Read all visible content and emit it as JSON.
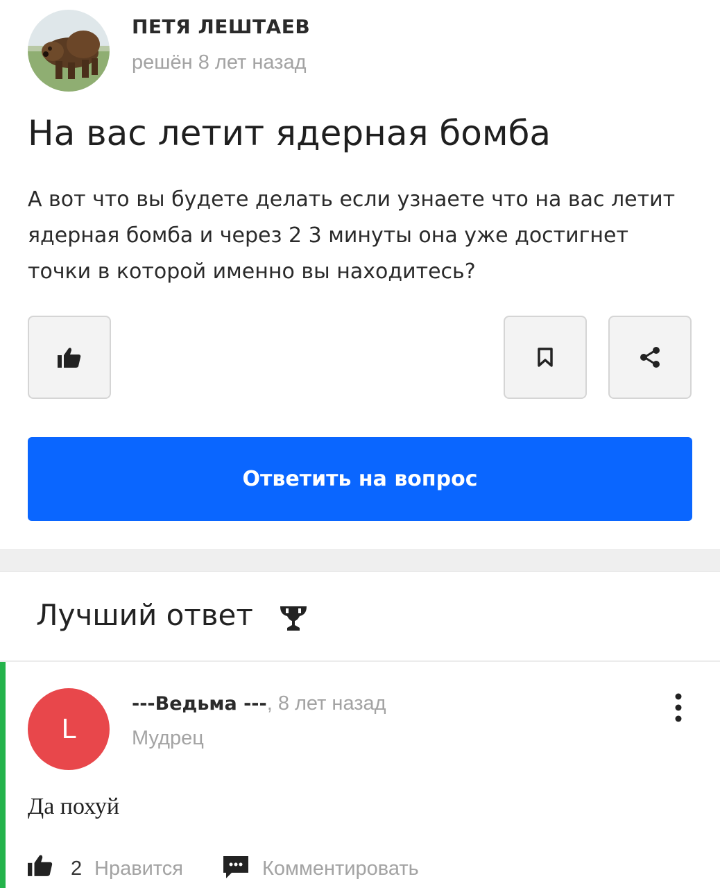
{
  "question": {
    "author_name": "ПЕТЯ ЛЕШТАЕВ",
    "author_meta": "решён 8 лет назад",
    "title": "На вас летит ядерная бомба",
    "body": "А вот что вы будете делать если узнаете что на вас летит ядерная бомба и через 2 3 минуты она уже достигнет точки в которой именно вы находитесь?",
    "answer_button_label": "Ответить на вопрос",
    "icons": [
      "thumbs-up-icon",
      "bookmark-icon",
      "share-icon"
    ]
  },
  "best_answer": {
    "heading": "Лучший ответ",
    "heading_icon": "trophy-icon",
    "avatar_letter": "L",
    "avatar_color": "#e8474b",
    "author_name": "---Ведьма ---",
    "time": ", 8 лет назад",
    "rank": "Мудрец",
    "text": "Да похуй",
    "like_count": "2",
    "like_label": "Нравится",
    "comment_label": "Комментировать"
  },
  "colors": {
    "accent_blue": "#0a66ff",
    "best_answer_green": "#24b34b",
    "muted_text": "#a3a3a3"
  }
}
